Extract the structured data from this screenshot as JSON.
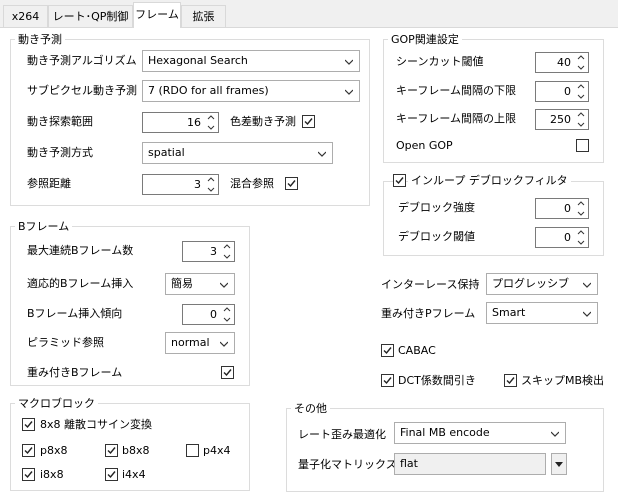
{
  "tabs": [
    "x264",
    "レート･QP制御",
    "フレーム",
    "拡張"
  ],
  "motion": {
    "title": "動き予測",
    "algo_label": "動き予測アルゴリズム",
    "algo_value": "Hexagonal Search",
    "subpel_label": "サブピクセル動き予測",
    "subpel_value": "7 (RDO for all frames)",
    "range_label": "動き探索範囲",
    "range_value": "16",
    "chroma_label": "色差動き予測",
    "mode_label": "動き予測方式",
    "mode_value": "spatial",
    "ref_label": "参照距離",
    "ref_value": "3",
    "mixed_label": "混合参照"
  },
  "gop": {
    "title": "GOP関連設定",
    "scenecut_label": "シーンカット閾値",
    "scenecut_value": "40",
    "keymin_label": "キーフレーム間隔の下限",
    "keymin_value": "0",
    "keymax_label": "キーフレーム間隔の上限",
    "keymax_value": "250",
    "opengop_label": "Open GOP"
  },
  "deblock": {
    "title": "インループ デブロックフィルタ",
    "strength_label": "デブロック強度",
    "strength_value": "0",
    "threshold_label": "デブロック閾値",
    "threshold_value": "0"
  },
  "bframe": {
    "title": "Bフレーム",
    "max_label": "最大連続Bフレーム数",
    "max_value": "3",
    "adaptive_label": "適応的Bフレーム挿入",
    "adaptive_value": "簡易",
    "bias_label": "Bフレーム挿入傾向",
    "bias_value": "0",
    "pyramid_label": "ピラミッド参照",
    "pyramid_value": "normal",
    "weighted_label": "重み付きBフレーム"
  },
  "interlace": {
    "label": "インターレース保持",
    "value": "プログレッシブ"
  },
  "weightp": {
    "label": "重み付きPフレーム",
    "value": "Smart"
  },
  "cabac_label": "CABAC",
  "dct_label": "DCT係数間引き",
  "skip_label": "スキップMB検出",
  "macroblock": {
    "title": "マクロブロック",
    "dct8x8_label": "8x8 離散コサイン変換",
    "p8x8": "p8x8",
    "b8x8": "b8x8",
    "p4x4": "p4x4",
    "i8x8": "i8x8",
    "i4x4": "i4x4"
  },
  "other": {
    "title": "その他",
    "rdo_label": "レート歪み最適化",
    "rdo_value": "Final MB encode",
    "matrix_label": "量子化マトリックス",
    "matrix_value": "flat"
  }
}
